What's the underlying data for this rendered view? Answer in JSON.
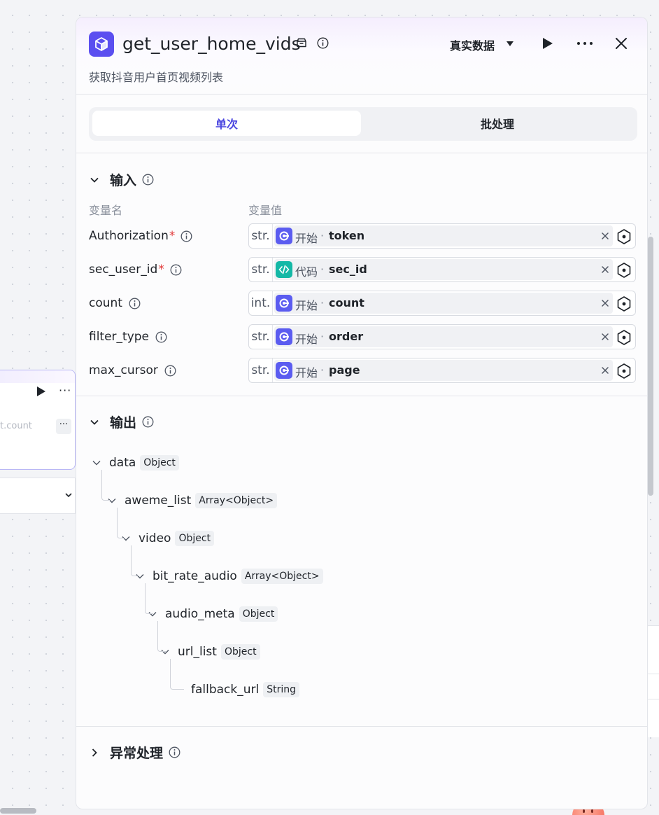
{
  "panel": {
    "title": "get_user_home_vids",
    "subtitle": "获取抖音用户首页视频列表",
    "data_source": "真实数据",
    "tabs": [
      {
        "label": "单次",
        "active": true
      },
      {
        "label": "批处理",
        "active": false
      }
    ]
  },
  "input_section": {
    "title": "输入",
    "col_name": "变量名",
    "col_value": "变量值",
    "rows": [
      {
        "name": "Authorization",
        "required": "*",
        "type": "str.",
        "source": "开始",
        "source_icon": "start-node-icon",
        "variable": "token"
      },
      {
        "name": "sec_user_id",
        "required": "*",
        "type": "str.",
        "source": "代码",
        "source_icon": "code-node-icon",
        "variable": "sec_id"
      },
      {
        "name": "count",
        "required": "",
        "type": "int.",
        "source": "开始",
        "source_icon": "start-node-icon",
        "variable": "count"
      },
      {
        "name": "filter_type",
        "required": "",
        "type": "str.",
        "source": "开始",
        "source_icon": "start-node-icon",
        "variable": "order"
      },
      {
        "name": "max_cursor",
        "required": "",
        "type": "str.",
        "source": "开始",
        "source_icon": "start-node-icon",
        "variable": "page"
      }
    ]
  },
  "output_section": {
    "title": "输出",
    "tree": [
      {
        "name": "data",
        "type": "Object"
      },
      {
        "name": "aweme_list",
        "type": "Array<Object>"
      },
      {
        "name": "video",
        "type": "Object"
      },
      {
        "name": "bit_rate_audio",
        "type": "Array<Object>"
      },
      {
        "name": "audio_meta",
        "type": "Object"
      },
      {
        "name": "url_list",
        "type": "Object"
      },
      {
        "name": "fallback_url",
        "type": "String"
      }
    ]
  },
  "exception_section": {
    "title": "异常处理"
  },
  "background": {
    "node_field_text": "t.count",
    "more_label": "···"
  },
  "colors": {
    "accent": "#4a45e0",
    "node_icon": "#5b4ff0",
    "start_icon": "#5b5cf0",
    "code_icon": "#14b8a6",
    "required": "#e23b3b"
  }
}
